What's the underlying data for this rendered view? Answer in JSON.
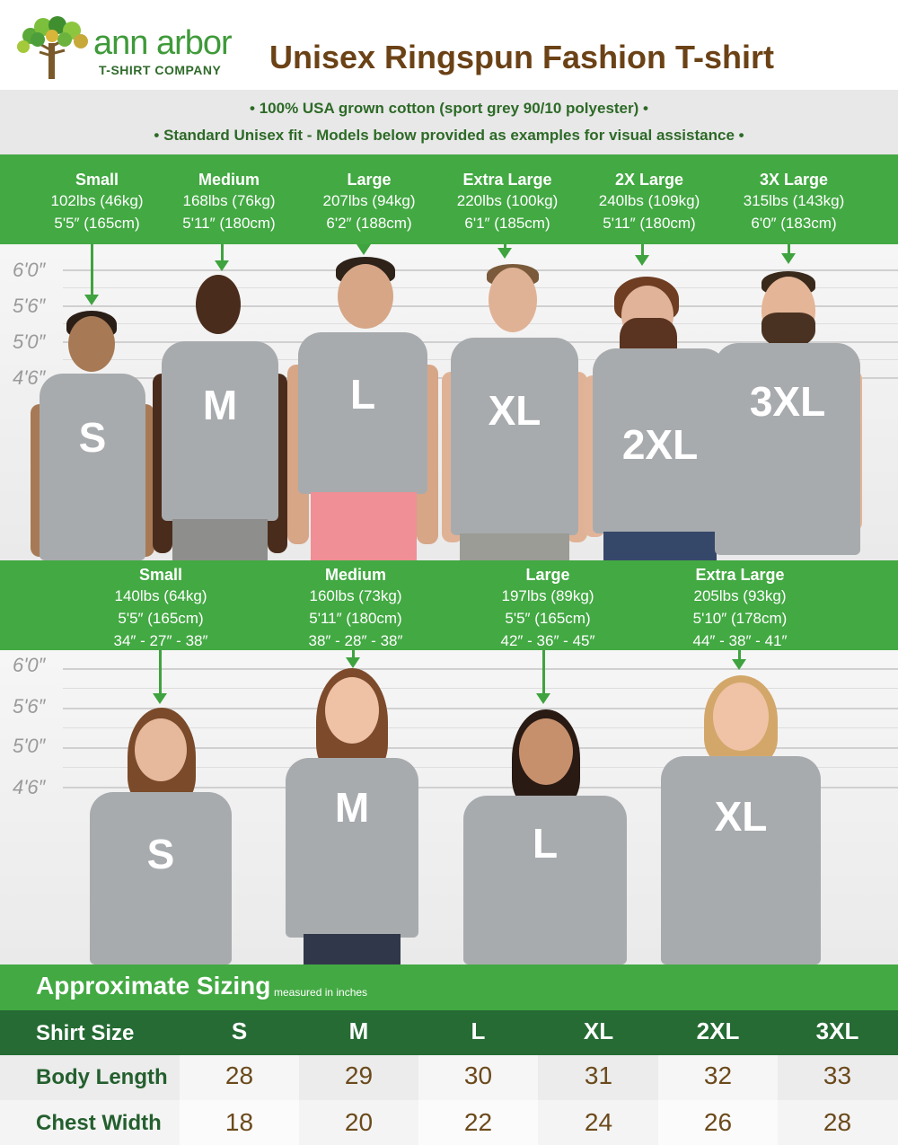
{
  "brand": {
    "name": "ann arbor",
    "sub": "T-SHIRT COMPANY"
  },
  "title": "Unisex Ringspun Fashion T-shirt",
  "info": {
    "line1": "• 100% USA grown cotton (sport grey 90/10 polyester) •",
    "line2": "• Standard Unisex fit - Models below provided as examples for visual assistance •"
  },
  "height_labels": [
    "6'0″",
    "5'6″",
    "5'0″",
    "4'6″"
  ],
  "men": [
    {
      "size": "Small",
      "weight": "102lbs (46kg)",
      "height": "5'5″ (165cm)",
      "label": "S"
    },
    {
      "size": "Medium",
      "weight": "168lbs (76kg)",
      "height": "5'11″ (180cm)",
      "label": "M"
    },
    {
      "size": "Large",
      "weight": "207lbs (94kg)",
      "height": "6'2″ (188cm)",
      "label": "L"
    },
    {
      "size": "Extra Large",
      "weight": "220lbs (100kg)",
      "height": "6'1″ (185cm)",
      "label": "XL"
    },
    {
      "size": "2X Large",
      "weight": "240lbs (109kg)",
      "height": "5'11″ (180cm)",
      "label": "2XL"
    },
    {
      "size": "3X Large",
      "weight": "315lbs (143kg)",
      "height": "6'0″ (183cm)",
      "label": "3XL"
    }
  ],
  "women": [
    {
      "size": "Small",
      "weight": "140lbs (64kg)",
      "height": "5'5″ (165cm)",
      "measure": "34″ - 27″ - 38″",
      "label": "S"
    },
    {
      "size": "Medium",
      "weight": "160lbs (73kg)",
      "height": "5'11″ (180cm)",
      "measure": "38″ - 28″ - 38″",
      "label": "M"
    },
    {
      "size": "Large",
      "weight": "197lbs (89kg)",
      "height": "5'5″ (165cm)",
      "measure": "42″ - 36″ - 45″",
      "label": "L"
    },
    {
      "size": "Extra Large",
      "weight": "205lbs (93kg)",
      "height": "5'10″ (178cm)",
      "measure": "44″ - 38″ - 41″",
      "label": "XL"
    }
  ],
  "sizing": {
    "title": "Approximate Sizing",
    "note": "measured in inches",
    "header_label": "Shirt Size",
    "sizes": [
      "S",
      "M",
      "L",
      "XL",
      "2XL",
      "3XL"
    ],
    "rows": [
      {
        "label": "Body Length",
        "values": [
          "28",
          "29",
          "30",
          "31",
          "32",
          "33"
        ]
      },
      {
        "label": "Chest Width",
        "values": [
          "18",
          "20",
          "22",
          "24",
          "26",
          "28"
        ]
      }
    ]
  },
  "colors": {
    "green": "#43a943",
    "dark_green": "#256b33",
    "brown": "#6b4216",
    "shirt": "#a8abae"
  }
}
